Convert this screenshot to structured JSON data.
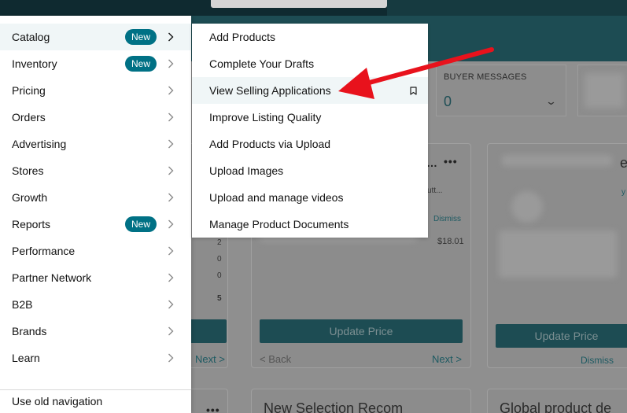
{
  "nav": {
    "items": [
      {
        "label": "Catalog",
        "badge": "New",
        "name": "catalog"
      },
      {
        "label": "Inventory",
        "badge": "New",
        "name": "inventory"
      },
      {
        "label": "Pricing",
        "badge": "",
        "name": "pricing"
      },
      {
        "label": "Orders",
        "badge": "",
        "name": "orders"
      },
      {
        "label": "Advertising",
        "badge": "",
        "name": "advertising"
      },
      {
        "label": "Stores",
        "badge": "",
        "name": "stores"
      },
      {
        "label": "Growth",
        "badge": "",
        "name": "growth"
      },
      {
        "label": "Reports",
        "badge": "New",
        "name": "reports"
      },
      {
        "label": "Performance",
        "badge": "",
        "name": "performance"
      },
      {
        "label": "Partner Network",
        "badge": "",
        "name": "partner-network"
      },
      {
        "label": "B2B",
        "badge": "",
        "name": "b2b"
      },
      {
        "label": "Brands",
        "badge": "",
        "name": "brands"
      },
      {
        "label": "Learn",
        "badge": "",
        "name": "learn"
      }
    ],
    "old_navigation": "Use old navigation"
  },
  "submenu": {
    "items": [
      {
        "label": "Add Products",
        "name": "add-products"
      },
      {
        "label": "Complete Your Drafts",
        "name": "complete-your-drafts"
      },
      {
        "label": "View Selling Applications",
        "name": "view-selling-applications"
      },
      {
        "label": "Improve Listing Quality",
        "name": "improve-listing-quality"
      },
      {
        "label": "Add Products via Upload",
        "name": "add-products-via-upload"
      },
      {
        "label": "Upload Images",
        "name": "upload-images"
      },
      {
        "label": "Upload and manage videos",
        "name": "upload-and-manage-videos"
      },
      {
        "label": "Manage Product Documents",
        "name": "manage-product-documents"
      }
    ]
  },
  "background": {
    "buyer_messages_label": "BUYER MESSAGES",
    "buyer_messages_value": "0",
    "card_title_fragment": "…",
    "card_dismiss": "Dismiss",
    "card_sub_fragment": "utt...",
    "price_fragment": "$18.01",
    "numbers": [
      "2",
      "0",
      "0",
      "5"
    ],
    "update_price": "Update Price",
    "back_link": "< Back",
    "next_link": "Next >",
    "next_link_left": "Next >",
    "update_price_right": "Update Price",
    "dismiss_right": "Dismiss",
    "new_selection": "New Selection Recom",
    "global_product": "Global product de",
    "letter_e": "e",
    "letter_y": "y"
  },
  "colors": {
    "accent": "#007185",
    "annotation_arrow": "#e8121c"
  }
}
